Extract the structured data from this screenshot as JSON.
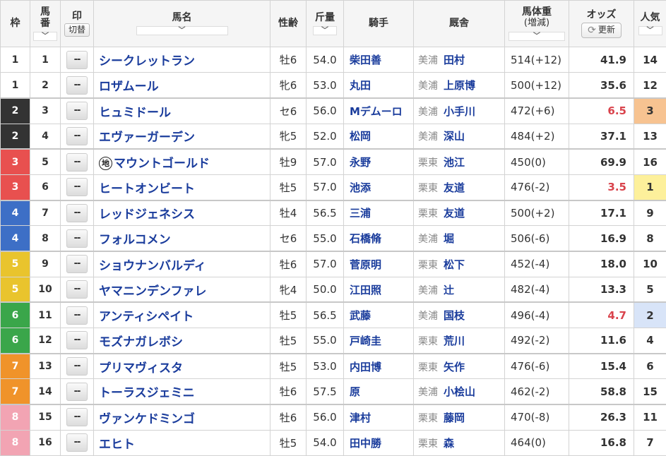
{
  "headers": {
    "waku": "枠",
    "umaban_1": "馬",
    "umaban_2": "番",
    "mark": "印",
    "mark_switch": "切替",
    "horse": "馬名",
    "sex_age": "性齢",
    "kinryo": "斤量",
    "jockey": "騎手",
    "stable": "厩舎",
    "weight_1": "馬体重",
    "weight_2": "(増減)",
    "odds": "オッズ",
    "refresh": "更新",
    "popularity": "人気",
    "sort_glyph": "﹀"
  },
  "mark_placeholder": "--",
  "chiho_badge": "地",
  "waku_colors": {
    "1": {
      "bg": "#ffffff",
      "fg": "#333333"
    },
    "2": {
      "bg": "#333333",
      "fg": "#ffffff"
    },
    "3": {
      "bg": "#e8504f",
      "fg": "#ffffff"
    },
    "4": {
      "bg": "#3d6fc6",
      "fg": "#ffffff"
    },
    "5": {
      "bg": "#e9c42d",
      "fg": "#ffffff"
    },
    "6": {
      "bg": "#3aa64a",
      "fg": "#ffffff"
    },
    "7": {
      "bg": "#f0932a",
      "fg": "#ffffff"
    },
    "8": {
      "bg": "#f2a4b3",
      "fg": "#ffffff"
    }
  },
  "rows": [
    {
      "waku": "1",
      "uma": "1",
      "horse": "シークレットラン",
      "chiho": false,
      "sex": "牡6",
      "kin": "54.0",
      "jockey": "柴田善",
      "region": "美浦",
      "trainer": "田村",
      "weight": "514(+12)",
      "odds": "41.9",
      "hot": false,
      "pop": "14"
    },
    {
      "waku": "1",
      "uma": "2",
      "horse": "ロザムール",
      "chiho": false,
      "sex": "牝6",
      "kin": "53.0",
      "jockey": "丸田",
      "region": "美浦",
      "trainer": "上原博",
      "weight": "500(+12)",
      "odds": "35.6",
      "hot": false,
      "pop": "12"
    },
    {
      "waku": "2",
      "uma": "3",
      "horse": "ヒュミドール",
      "chiho": false,
      "sex": "セ6",
      "kin": "56.0",
      "jockey": "Mデムーロ",
      "region": "美浦",
      "trainer": "小手川",
      "weight": "472(+6)",
      "odds": "6.5",
      "hot": true,
      "pop": "3"
    },
    {
      "waku": "2",
      "uma": "4",
      "horse": "エヴァーガーデン",
      "chiho": false,
      "sex": "牝5",
      "kin": "52.0",
      "jockey": "松岡",
      "region": "美浦",
      "trainer": "深山",
      "weight": "484(+2)",
      "odds": "37.1",
      "hot": false,
      "pop": "13"
    },
    {
      "waku": "3",
      "uma": "5",
      "horse": "マウントゴールド",
      "chiho": true,
      "sex": "牡9",
      "kin": "57.0",
      "jockey": "永野",
      "region": "栗東",
      "trainer": "池江",
      "weight": "450(0)",
      "odds": "69.9",
      "hot": false,
      "pop": "16"
    },
    {
      "waku": "3",
      "uma": "6",
      "horse": "ヒートオンビート",
      "chiho": false,
      "sex": "牡5",
      "kin": "57.0",
      "jockey": "池添",
      "region": "栗東",
      "trainer": "友道",
      "weight": "476(-2)",
      "odds": "3.5",
      "hot": true,
      "pop": "1"
    },
    {
      "waku": "4",
      "uma": "7",
      "horse": "レッドジェネシス",
      "chiho": false,
      "sex": "牡4",
      "kin": "56.5",
      "jockey": "三浦",
      "region": "栗東",
      "trainer": "友道",
      "weight": "500(+2)",
      "odds": "17.1",
      "hot": false,
      "pop": "9"
    },
    {
      "waku": "4",
      "uma": "8",
      "horse": "フォルコメン",
      "chiho": false,
      "sex": "セ6",
      "kin": "55.0",
      "jockey": "石橋脩",
      "region": "美浦",
      "trainer": "堀",
      "weight": "506(-6)",
      "odds": "16.9",
      "hot": false,
      "pop": "8"
    },
    {
      "waku": "5",
      "uma": "9",
      "horse": "ショウナンバルディ",
      "chiho": false,
      "sex": "牡6",
      "kin": "57.0",
      "jockey": "菅原明",
      "region": "栗東",
      "trainer": "松下",
      "weight": "452(-4)",
      "odds": "18.0",
      "hot": false,
      "pop": "10"
    },
    {
      "waku": "5",
      "uma": "10",
      "horse": "ヤマニンデンファレ",
      "chiho": false,
      "sex": "牝4",
      "kin": "50.0",
      "jockey": "江田照",
      "region": "美浦",
      "trainer": "辻",
      "weight": "482(-4)",
      "odds": "13.3",
      "hot": false,
      "pop": "5"
    },
    {
      "waku": "6",
      "uma": "11",
      "horse": "アンティシペイト",
      "chiho": false,
      "sex": "牡5",
      "kin": "56.5",
      "jockey": "武藤",
      "region": "美浦",
      "trainer": "国枝",
      "weight": "496(-4)",
      "odds": "4.7",
      "hot": true,
      "pop": "2"
    },
    {
      "waku": "6",
      "uma": "12",
      "horse": "モズナガレボシ",
      "chiho": false,
      "sex": "牡5",
      "kin": "55.0",
      "jockey": "戸崎圭",
      "region": "栗東",
      "trainer": "荒川",
      "weight": "492(-2)",
      "odds": "11.6",
      "hot": false,
      "pop": "4"
    },
    {
      "waku": "7",
      "uma": "13",
      "horse": "プリマヴィスタ",
      "chiho": false,
      "sex": "牡5",
      "kin": "53.0",
      "jockey": "内田博",
      "region": "栗東",
      "trainer": "矢作",
      "weight": "476(-6)",
      "odds": "15.4",
      "hot": false,
      "pop": "6"
    },
    {
      "waku": "7",
      "uma": "14",
      "horse": "トーラスジェミニ",
      "chiho": false,
      "sex": "牡6",
      "kin": "57.5",
      "jockey": "原",
      "region": "美浦",
      "trainer": "小桧山",
      "weight": "462(-2)",
      "odds": "58.8",
      "hot": false,
      "pop": "15"
    },
    {
      "waku": "8",
      "uma": "15",
      "horse": "ヴァンケドミンゴ",
      "chiho": false,
      "sex": "牡6",
      "kin": "56.0",
      "jockey": "津村",
      "region": "栗東",
      "trainer": "藤岡",
      "weight": "470(-8)",
      "odds": "26.3",
      "hot": false,
      "pop": "11"
    },
    {
      "waku": "8",
      "uma": "16",
      "horse": "エヒト",
      "chiho": false,
      "sex": "牡5",
      "kin": "54.0",
      "jockey": "田中勝",
      "region": "栗東",
      "trainer": "森",
      "weight": "464(0)",
      "odds": "16.8",
      "hot": false,
      "pop": "7"
    }
  ]
}
